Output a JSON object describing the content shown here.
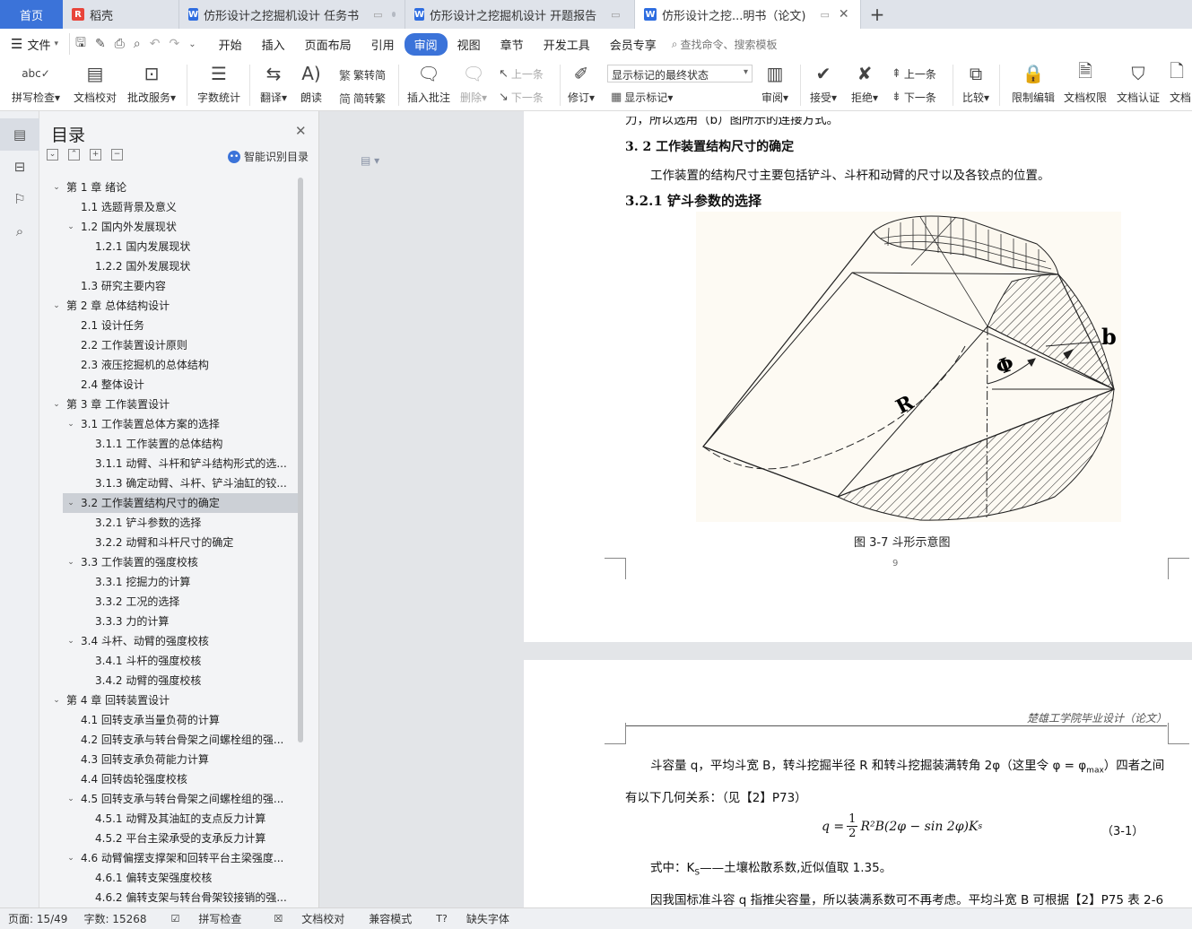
{
  "tabs": {
    "home": "首页",
    "items": [
      {
        "label": "稻壳",
        "logo": "R"
      },
      {
        "label": "仿形设计之挖掘机设计 任务书",
        "logo": "W"
      },
      {
        "label": "仿形设计之挖掘机设计 开题报告",
        "logo": "W"
      },
      {
        "label": "仿形设计之挖...明书（论文)",
        "logo": "W"
      }
    ]
  },
  "menu": {
    "file": "文件",
    "items": [
      "开始",
      "插入",
      "页面布局",
      "引用",
      "审阅",
      "视图",
      "章节",
      "开发工具",
      "会员专享"
    ],
    "active": "审阅",
    "search": "查找命令、搜索模板"
  },
  "ribbon": {
    "spell": "拼写检查",
    "proof": "文档校对",
    "annotate_service": "批改服务",
    "word_count": "字数统计",
    "translate": "翻译",
    "read": "朗读",
    "to_traditional": "繁转简",
    "to_simplified": "简转繁",
    "insert_comment": "插入批注",
    "delete": "删除",
    "prev": "上一条",
    "next": "下一条",
    "revise": "修订",
    "markup_select": "显示标记的最终状态",
    "show_markup": "显示标记",
    "review": "审阅",
    "accept": "接受",
    "reject": "拒绝",
    "prev2": "上一条",
    "next2": "下一条",
    "compare": "比较",
    "restrict": "限制编辑",
    "permission": "文档权限",
    "certify": "文档认证",
    "more": "文档"
  },
  "toc": {
    "title": "目录",
    "smart": "智能识别目录",
    "items": [
      {
        "label": "第 1 章  绪论",
        "level": 0,
        "exp": true
      },
      {
        "label": "1.1 选题背景及意义",
        "level": 1
      },
      {
        "label": "1.2 国内外发展现状",
        "level": 1,
        "exp": true
      },
      {
        "label": "1.2.1 国内发展现状",
        "level": 2
      },
      {
        "label": "1.2.2 国外发展现状",
        "level": 2
      },
      {
        "label": "1.3 研究主要内容",
        "level": 1
      },
      {
        "label": "第 2 章  总体结构设计",
        "level": 0,
        "exp": true
      },
      {
        "label": "2.1 设计任务",
        "level": 1
      },
      {
        "label": "2.2 工作装置设计原则",
        "level": 1
      },
      {
        "label": "2.3 液压挖掘机的总体结构",
        "level": 1
      },
      {
        "label": "2.4 整体设计",
        "level": 1
      },
      {
        "label": "第 3 章  工作装置设计",
        "level": 0,
        "exp": true
      },
      {
        "label": "3.1  工作装置总体方案的选择",
        "level": 1,
        "exp": true
      },
      {
        "label": "3.1.1 工作装置的总体结构",
        "level": 2
      },
      {
        "label": "3.1.1 动臂、斗杆和铲斗结构形式的选...",
        "level": 2
      },
      {
        "label": "3.1.3 确定动臂、斗杆、铲斗油缸的铰...",
        "level": 2
      },
      {
        "label": "3.2 工作装置结构尺寸的确定",
        "level": 1,
        "exp": true,
        "sel": true
      },
      {
        "label": "3.2.1 铲斗参数的选择",
        "level": 2
      },
      {
        "label": "3.2.2 动臂和斗杆尺寸的确定",
        "level": 2
      },
      {
        "label": "3.3 工作装置的强度校核",
        "level": 1,
        "exp": true
      },
      {
        "label": "3.3.1 挖掘力的计算",
        "level": 2
      },
      {
        "label": "3.3.2 工况的选择",
        "level": 2
      },
      {
        "label": "3.3.3 力的计算",
        "level": 2
      },
      {
        "label": "3.4 斗杆、动臂的强度校核",
        "level": 1,
        "exp": true
      },
      {
        "label": "3.4.1 斗杆的强度校核",
        "level": 2
      },
      {
        "label": "3.4.2 动臂的强度校核",
        "level": 2
      },
      {
        "label": "第 4 章  回转装置设计",
        "level": 0,
        "exp": true
      },
      {
        "label": "4.1 回转支承当量负荷的计算",
        "level": 1
      },
      {
        "label": "4.2 回转支承与转台骨架之间螺栓组的强...",
        "level": 1
      },
      {
        "label": "4.3 回转支承负荷能力计算",
        "level": 1
      },
      {
        "label": "4.4 回转齿轮强度校核",
        "level": 1
      },
      {
        "label": "4.5  回转支承与转台骨架之间螺栓组的强...",
        "level": 1,
        "exp": true
      },
      {
        "label": "4.5.1  动臂及其油缸的支点反力计算",
        "level": 2
      },
      {
        "label": "4.5.2  平台主梁承受的支承反力计算",
        "level": 2
      },
      {
        "label": "4.6 动臂偏摆支撑架和回转平台主梁强度...",
        "level": 1,
        "exp": true
      },
      {
        "label": "4.6.1  偏转支架强度校核",
        "level": 2
      },
      {
        "label": "4.6.2  偏转支架与转台骨架铰接销的强...",
        "level": 2
      }
    ]
  },
  "doc": {
    "cut_line": "力，所以选用（b）图所示的连接方式。",
    "h_32": "3. 2 工作装置结构尺寸的确定",
    "p_32": "工作装置的结构尺寸主要包括铲斗、斗杆和动臂的尺寸以及各铰点的位置。",
    "h_321": "3.2.1 铲斗参数的选择",
    "fig_R": "R",
    "fig_phi": "Φ",
    "fig_b": "b",
    "caption": "图 3-7    斗形示意图",
    "page_number": "9",
    "running_header": "楚雄工学院毕业设计（论文）",
    "p2_line1": "斗容量 q，平均斗宽 B，转斗挖掘半径 R 和转斗挖掘装满转角 2φ（这里令 φ = φ",
    "p2_line1_sub": "max",
    "p2_line1_end": "）四者之间",
    "p2_line2": "有以下几何关系：（见【2】P73）",
    "formula_lhs": "q =",
    "formula_num": "1",
    "formula_den": "2",
    "formula_rhs": "R²B(2φ − sin 2φ)K",
    "formula_sub": "s",
    "eq_num": "（3-1）",
    "p2_line3": "式中：K",
    "p2_line3_sub": "S",
    "p2_line3_end": "——土壤松散系数,近似值取 1.35。",
    "p2_line4": "因我国标准斗容 q 指推尖容量，所以装满系数可不再考虑。平均斗宽 B 可根据【2】P75 表 2-6"
  },
  "status": {
    "page": "页面: 15/49",
    "words": "字数: 15268",
    "spell": "拼写检查",
    "proof": "文档校对",
    "compat": "兼容模式",
    "font_missing": "缺失字体"
  }
}
